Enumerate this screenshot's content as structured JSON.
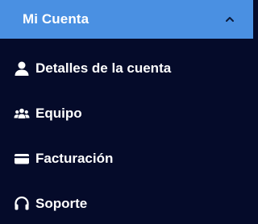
{
  "account_menu": {
    "title": "Mi Cuenta",
    "expanded_icon": "chevron-up-icon",
    "items": [
      {
        "label": "Detalles de la cuenta",
        "icon": "user-icon"
      },
      {
        "label": "Equipo",
        "icon": "team-icon"
      },
      {
        "label": "Facturación",
        "icon": "credit-card-icon"
      },
      {
        "label": "Soporte",
        "icon": "headset-icon"
      }
    ]
  },
  "colors": {
    "header_background": "#4a90e2",
    "menu_background": "#050b2a",
    "text": "#ffffff"
  }
}
